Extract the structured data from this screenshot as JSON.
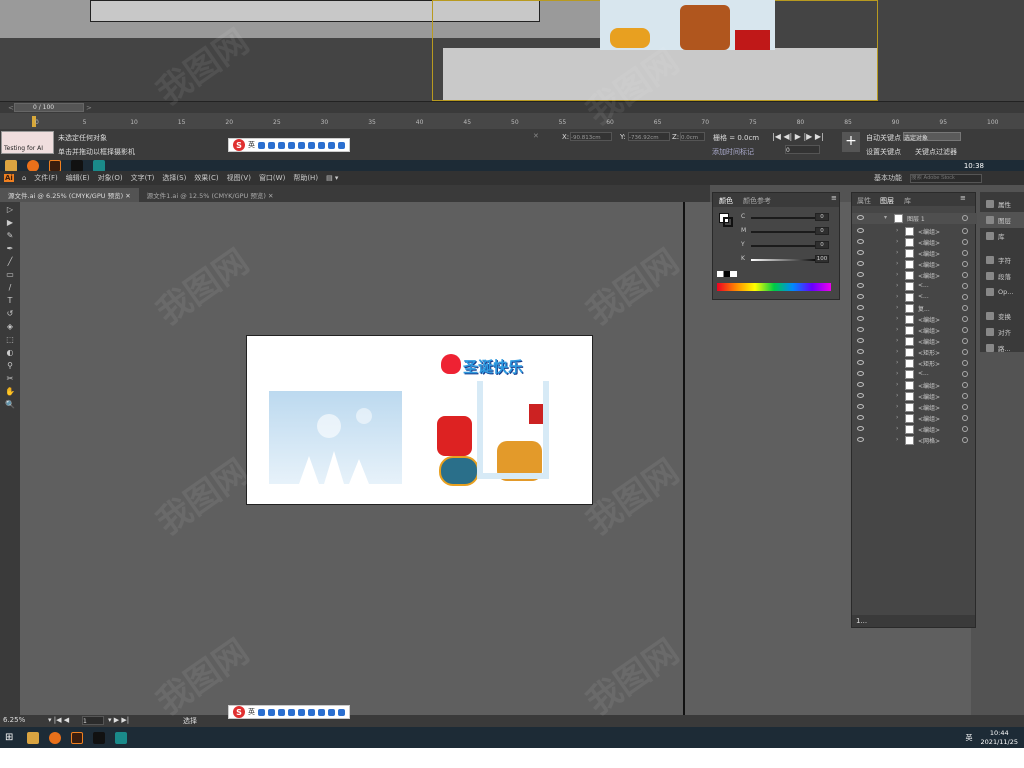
{
  "max": {
    "frame_label": "0 / 100",
    "ruler_ticks": [
      "0",
      "5",
      "10",
      "15",
      "20",
      "25",
      "30",
      "35",
      "40",
      "45",
      "50",
      "55",
      "60",
      "65",
      "70",
      "75",
      "80",
      "85",
      "90",
      "95",
      "100"
    ],
    "testing_label": "Testing for AI",
    "status_line1": "未选定任何对象",
    "status_line2": "单击并拖动以框择摄影机",
    "coord_x_label": "X:",
    "coord_x": "-90.813cm",
    "coord_y_label": "Y:",
    "coord_y": "-736.92cm",
    "coord_z_label": "Z:",
    "coord_z": "0.0cm",
    "grid_label": "栅格 = 0.0cm",
    "add_tag": "添加时间标记",
    "auto_key": "自动关键点",
    "set_key": "设置关键点",
    "selected_obj": "选定对象",
    "key_filter": "关键点过滤器",
    "frame_num": "0"
  },
  "ime": {
    "lang": "英",
    "logo": "S"
  },
  "taskbar_top": {
    "time": "10:38"
  },
  "ai": {
    "menus": [
      "文件(F)",
      "编辑(E)",
      "对象(O)",
      "文字(T)",
      "选择(S)",
      "效果(C)",
      "视图(V)",
      "窗口(W)",
      "帮助(H)"
    ],
    "workspace": "基本功能",
    "search_placeholder": "搜索 Adobe Stock",
    "tabs": [
      "源文件.ai @ 6.25% (CMYK/GPU 预览)",
      "源文件1.ai @ 12.5% (CMYK/GPU 预览)"
    ],
    "zoom": "6.25%",
    "page": "1",
    "status_tool": "选择",
    "tools": [
      "▷",
      "▶",
      "✎",
      "✒",
      "╱",
      "▭",
      "/",
      "T",
      "↺",
      "◈",
      "⬚",
      "◐",
      "⚲",
      "✂",
      "✋",
      "🔍"
    ]
  },
  "color_panel": {
    "tabs": [
      "颜色",
      "颜色参考"
    ],
    "channels": [
      {
        "name": "C",
        "value": "0"
      },
      {
        "name": "M",
        "value": "0"
      },
      {
        "name": "Y",
        "value": "0"
      },
      {
        "name": "K",
        "value": "100"
      }
    ]
  },
  "layers_panel": {
    "tabs": [
      "属性",
      "图层",
      "库"
    ],
    "layer_name": "图层 1",
    "rows": [
      "<编组>",
      "<编组>",
      "<编组>",
      "<编组>",
      "<编组>",
      "<...",
      "<...",
      "复...",
      "<编组>",
      "<编组>",
      "<编组>",
      "<矩形>",
      "<矩形>",
      "<...",
      "<编组>",
      "<编组>",
      "<编组>",
      "<编组>",
      "<编组>",
      "<网格>"
    ],
    "footer": "1..."
  },
  "dock": [
    "属性",
    "图层",
    "库",
    "字符",
    "段落",
    "Op...",
    "变换",
    "对齐",
    "路..."
  ],
  "artboard": {
    "banner": "圣诞快乐"
  },
  "taskbar": {
    "lang": "英",
    "time": "10:44",
    "date": "2021/11/25"
  },
  "watermark": "我图网"
}
